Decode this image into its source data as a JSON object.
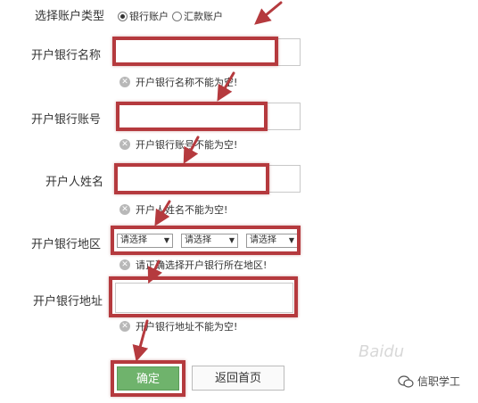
{
  "form": {
    "account_type_label": "选择账户类型",
    "account_options": [
      {
        "label": "银行账户",
        "checked": true
      },
      {
        "label": "汇款账户",
        "checked": false
      }
    ],
    "bank_name_label": "开户银行名称",
    "bank_name_error": "开户银行名称不能为空!",
    "account_no_label": "开户银行账号",
    "account_no_error": "开户银行账号不能为空!",
    "holder_label": "开户人姓名",
    "holder_error": "开户人姓名不能为空!",
    "region_label": "开户银行地区",
    "region_selects": [
      "请选择",
      "请选择",
      "请选择"
    ],
    "region_error": "请正确选择开户银行所在地区!",
    "address_label": "开户银行地址",
    "address_error": "开户银行地址不能为空!",
    "confirm_label": "确定",
    "back_label": "返回首页"
  },
  "watermark": {
    "text": "信职学工",
    "faint_text": "Baidu"
  },
  "colors": {
    "highlight": "#b53a3e",
    "confirm_bg": "#6fb36c"
  },
  "icons": [
    "error-x-icon",
    "chevron-down-icon",
    "annotation-arrow",
    "wechat-logo-icon"
  ]
}
